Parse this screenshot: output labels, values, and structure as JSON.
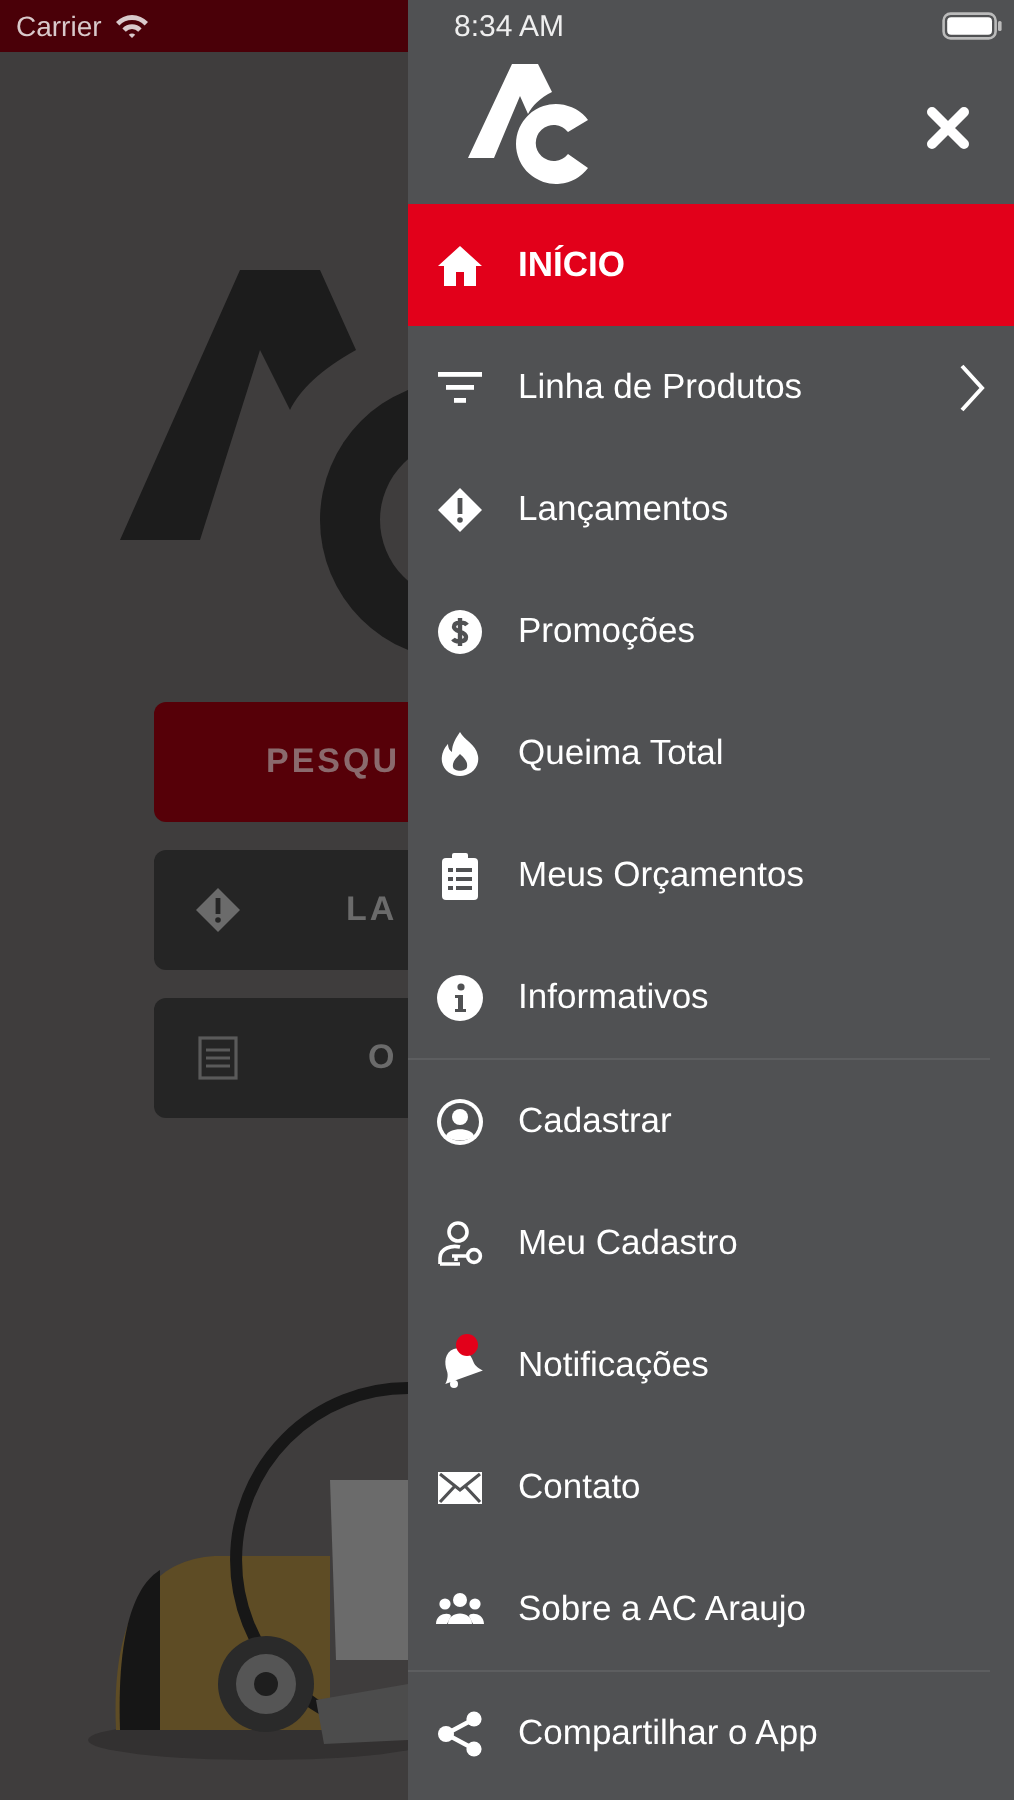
{
  "status_bar": {
    "carrier": "Carrier",
    "time": "8:34 AM"
  },
  "background": {
    "buttons": [
      {
        "label": "PESQU",
        "kind": "primary"
      },
      {
        "label": "LA",
        "kind": "dark"
      },
      {
        "label": "O",
        "kind": "dark"
      }
    ]
  },
  "drawer": {
    "sections": [
      [
        {
          "label": "INÍCIO",
          "selected": true
        },
        {
          "label": "Linha de Produtos",
          "selected": false,
          "submenu": true
        },
        {
          "label": "Lançamentos",
          "selected": false
        },
        {
          "label": "Promoções",
          "selected": false
        },
        {
          "label": "Queima Total",
          "selected": false
        },
        {
          "label": "Meus Orçamentos",
          "selected": false
        },
        {
          "label": "Informativos",
          "selected": false
        }
      ],
      [
        {
          "label": "Cadastrar",
          "selected": false
        },
        {
          "label": "Meu Cadastro",
          "selected": false
        },
        {
          "label": "Notificações",
          "selected": false,
          "unread": true
        },
        {
          "label": "Contato",
          "selected": false
        },
        {
          "label": "Sobre a AC Araujo",
          "selected": false
        }
      ],
      [
        {
          "label": "Compartilhar o App",
          "selected": false
        }
      ]
    ]
  }
}
